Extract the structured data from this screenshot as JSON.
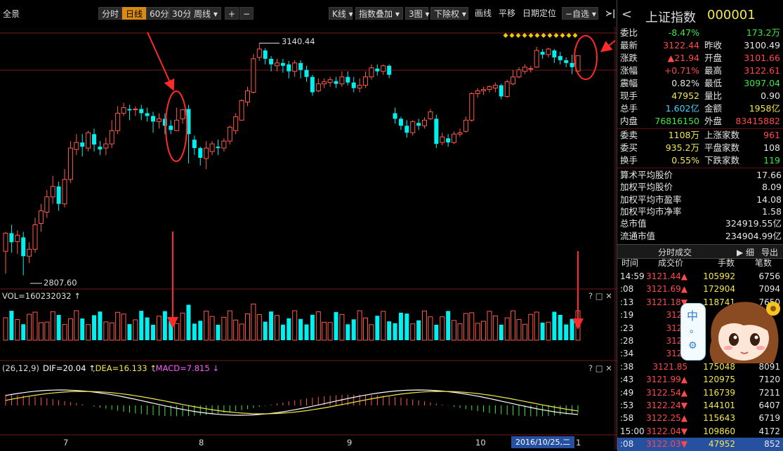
{
  "top": {
    "left_label": "全景",
    "periods": [
      "分时",
      "日线",
      "60分",
      "30分",
      "周线 ▾"
    ],
    "zoom_in": "+",
    "zoom_out": "−",
    "k_type": "K线 ▾",
    "index_overlay": "指数叠加 ▾",
    "charts_count": "3图 ▾",
    "rights": "下除权 ▾",
    "draw": "画线",
    "pan": "平移",
    "date_locate": "日期定位",
    "watchlist": "−自选 ▾",
    "collapse": "≻|"
  },
  "main_chart": {
    "high_label": "3140.44",
    "low_label": "2807.60",
    "candles": [
      [
        2842,
        2868,
        2810,
        2870
      ],
      [
        2868,
        2855,
        2840,
        2880
      ],
      [
        2856,
        2865,
        2838,
        2872
      ],
      [
        2862,
        2835,
        2807.6,
        2870
      ],
      [
        2835,
        2845,
        2825,
        2855
      ],
      [
        2845,
        2880,
        2840,
        2890
      ],
      [
        2882,
        2900,
        2870,
        2910
      ],
      [
        2898,
        2920,
        2890,
        2930
      ],
      [
        2920,
        2935,
        2910,
        2950
      ],
      [
        2935,
        2910,
        2900,
        2942
      ],
      [
        2910,
        2945,
        2905,
        2960
      ],
      [
        2945,
        2990,
        2940,
        3000
      ],
      [
        2988,
        2998,
        2980,
        3010
      ],
      [
        2998,
        2992,
        2978,
        3010
      ],
      [
        2990,
        3012,
        2985,
        3015
      ],
      [
        3010,
        2995,
        2985,
        3018
      ],
      [
        2992,
        2988,
        2980,
        3000
      ],
      [
        2990,
        2996,
        2980,
        3005
      ],
      [
        2996,
        3015,
        2990,
        3030
      ],
      [
        3015,
        3040,
        3010,
        3050
      ],
      [
        3040,
        3048,
        3036,
        3055
      ],
      [
        3046,
        3044,
        3030,
        3052
      ],
      [
        3045,
        3046,
        3036,
        3050
      ],
      [
        3046,
        3040,
        3030,
        3052
      ],
      [
        3040,
        3036,
        3028,
        3048
      ],
      [
        3036,
        3028,
        3012,
        3042
      ],
      [
        3028,
        3032,
        3018,
        3040
      ],
      [
        3032,
        3022,
        3010,
        3040
      ],
      [
        3022,
        3016,
        3010,
        3030
      ],
      [
        3015,
        3030,
        3014,
        3048
      ],
      [
        3032,
        3045,
        3025,
        3046
      ],
      [
        3046,
        3010,
        2968,
        3052
      ],
      [
        3002,
        2990,
        2980,
        3008
      ],
      [
        2990,
        2976,
        2965,
        2992
      ],
      [
        2975,
        2990,
        2960,
        3000
      ],
      [
        2985,
        2996,
        2980,
        3000
      ],
      [
        2992,
        2990,
        2980,
        3002
      ],
      [
        2990,
        3000,
        2985,
        3004
      ],
      [
        3000,
        3020,
        2995,
        3022
      ],
      [
        3015,
        3035,
        3010,
        3040
      ],
      [
        3030,
        3058,
        3030,
        3060
      ],
      [
        3056,
        3072,
        3050,
        3078
      ],
      [
        3070,
        3118,
        3068,
        3125
      ],
      [
        3120,
        3132,
        3115,
        3140.44
      ],
      [
        3130,
        3118,
        3110,
        3133
      ],
      [
        3118,
        3110,
        3100,
        3122
      ],
      [
        3108,
        3112,
        3100,
        3118
      ],
      [
        3112,
        3108,
        3098,
        3118
      ],
      [
        3110,
        3100,
        3090,
        3115
      ],
      [
        3100,
        3112,
        3092,
        3116
      ],
      [
        3112,
        3102,
        3090,
        3116
      ],
      [
        3102,
        3092,
        3085,
        3108
      ],
      [
        3092,
        3070,
        3065,
        3095
      ],
      [
        3072,
        3082,
        3070,
        3090
      ],
      [
        3082,
        3085,
        3076,
        3090
      ],
      [
        3084,
        3088,
        3078,
        3092
      ],
      [
        3086,
        3082,
        3076,
        3092
      ],
      [
        3082,
        3092,
        3078,
        3100
      ],
      [
        3092,
        3084,
        3080,
        3100
      ],
      [
        3084,
        3076,
        3070,
        3092
      ],
      [
        3076,
        3080,
        3070,
        3090
      ],
      [
        3080,
        3092,
        3076,
        3100
      ],
      [
        3092,
        3105,
        3088,
        3110
      ],
      [
        3104,
        3100,
        3094,
        3110
      ],
      [
        3100,
        3108,
        3095,
        3110
      ],
      [
        3108,
        3095,
        3090,
        3110
      ],
      [
        3040,
        3032,
        3025,
        3048
      ],
      [
        3032,
        3022,
        3016,
        3035
      ],
      [
        3022,
        3012,
        3005,
        3030
      ],
      [
        3012,
        3028,
        3008,
        3030
      ],
      [
        3026,
        3022,
        3016,
        3032
      ],
      [
        3022,
        3030,
        3018,
        3034
      ],
      [
        3032,
        3042,
        3030,
        3046
      ],
      [
        3032,
        2996,
        2990,
        3038
      ],
      [
        2998,
        3006,
        2994,
        3012
      ],
      [
        3004,
        2998,
        2992,
        3010
      ],
      [
        2998,
        3010,
        2996,
        3014
      ],
      [
        3010,
        3012,
        3006,
        3018
      ],
      [
        3014,
        3030,
        3012,
        3035
      ],
      [
        3030,
        3068,
        3028,
        3070
      ],
      [
        3068,
        3072,
        3062,
        3076
      ],
      [
        3072,
        3074,
        3066,
        3078
      ],
      [
        3074,
        3078,
        3070,
        3080
      ],
      [
        3076,
        3080,
        3070,
        3084
      ],
      [
        3080,
        3064,
        3060,
        3082
      ],
      [
        3064,
        3085,
        3062,
        3088
      ],
      [
        3082,
        3092,
        3080,
        3102
      ],
      [
        3092,
        3102,
        3090,
        3106
      ],
      [
        3100,
        3106,
        3096,
        3110
      ],
      [
        3104,
        3104,
        3098,
        3108
      ],
      [
        3106,
        3130,
        3105,
        3135
      ],
      [
        3128,
        3124,
        3118,
        3132
      ],
      [
        3124,
        3132,
        3120,
        3134
      ],
      [
        3130,
        3120,
        3112,
        3132
      ],
      [
        3122,
        3116,
        3110,
        3128
      ],
      [
        3116,
        3112,
        3106,
        3120
      ],
      [
        3112,
        3106,
        3096,
        3124
      ],
      [
        3100.49,
        3122.44,
        3097.04,
        3122.61
      ]
    ]
  },
  "vol_panel": {
    "label": "VOL=160232032 ↑"
  },
  "macd_panel": {
    "params": "(26,12,9)",
    "dif": "DIF=20.04 ↑",
    "dea": ",DEA=16.133 ↑",
    "macd": ",MACD=7.815 ↓"
  },
  "date_axis": {
    "labels": [
      "7",
      "8",
      "9",
      "10"
    ],
    "current_date": "2016/10/25,二",
    "last": "1"
  },
  "quote": {
    "back": "<",
    "name": "上证指数",
    "code": "000001",
    "rows": [
      {
        "l1": "委比",
        "v1": "-8.47%",
        "c1": "green",
        "l2": "",
        "v2": "173.2万",
        "c2": "green"
      },
      {
        "l1": "最新",
        "v1": "3122.44",
        "c1": "red",
        "l2": "昨收",
        "v2": "3100.49",
        "c2": "white"
      },
      {
        "l1": "涨跌",
        "v1": "▲21.94",
        "c1": "red",
        "l2": "开盘",
        "v2": "3101.66",
        "c2": "red"
      },
      {
        "l1": "涨幅",
        "v1": "+0.71%",
        "c1": "red",
        "l2": "最高",
        "v2": "3122.61",
        "c2": "red"
      },
      {
        "l1": "震幅",
        "v1": "0.82%",
        "c1": "white",
        "l2": "最低",
        "v2": "3097.04",
        "c2": "green"
      },
      {
        "l1": "现手",
        "v1": "47952",
        "c1": "yellow",
        "l2": "量比",
        "v2": "0.90",
        "c2": "white"
      },
      {
        "l1": "总手",
        "v1": "1.602亿",
        "c1": "cyan",
        "l2": "金额",
        "v2": "1958亿",
        "c2": "yellow"
      },
      {
        "l1": "内盘",
        "v1": "76816150",
        "c1": "green",
        "l2": "外盘",
        "v2": "83415882",
        "c2": "red"
      }
    ],
    "rows2": [
      {
        "l1": "委卖",
        "v1": "1108万",
        "c1": "yellow",
        "l2": "上涨家数",
        "v2": "961",
        "c2": "red"
      },
      {
        "l1": "委买",
        "v1": "935.2万",
        "c1": "yellow",
        "l2": "平盘家数",
        "v2": "108",
        "c2": "white"
      },
      {
        "l1": "换手",
        "v1": "0.55%",
        "c1": "yellow",
        "l2": "下跌家数",
        "v2": "119",
        "c2": "green"
      }
    ],
    "stats": [
      {
        "label": "算术平均股价",
        "value": "17.66"
      },
      {
        "label": "加权平均股价",
        "value": "8.09"
      },
      {
        "label": "加权平均市盈率",
        "value": "14.08"
      },
      {
        "label": "加权平均市净率",
        "value": "1.58"
      },
      {
        "label": "总市值",
        "value": "324919.55亿"
      },
      {
        "label": "流通市值",
        "value": "234904.99亿"
      }
    ]
  },
  "trades": {
    "tab": "分时成交",
    "tab2": "▶ 细",
    "export": "导出",
    "headers": [
      "时间",
      "成交价",
      "手数",
      "笔数"
    ],
    "rows": [
      {
        "t": "14:59",
        "p": "3121.44▲",
        "pc": "red",
        "v": "105992",
        "vc": "yellow",
        "n": "6756"
      },
      {
        "t": ":08",
        "p": "3121.69▲",
        "pc": "red",
        "v": "172904",
        "vc": "yellow",
        "n": "7094"
      },
      {
        "t": ":13",
        "p": "3121.18▼",
        "pc": "red",
        "v": "118741",
        "vc": "yellow",
        "n": "7650"
      },
      {
        "t": ":19",
        "p": "3121",
        "pc": "red",
        "v": "",
        "vc": "yellow",
        "n": ""
      },
      {
        "t": ":23",
        "p": "3121",
        "pc": "red",
        "v": "",
        "vc": "yellow",
        "n": ""
      },
      {
        "t": ":28",
        "p": "3120",
        "pc": "red",
        "v": "",
        "vc": "yellow",
        "n": ""
      },
      {
        "t": ":34",
        "p": "3121",
        "pc": "red",
        "v": "",
        "vc": "yellow",
        "n": ""
      },
      {
        "t": ":38",
        "p": "3121.85",
        "pc": "red",
        "v": "175048",
        "vc": "yellow",
        "n": "8091"
      },
      {
        "t": ":43",
        "p": "3121.99▲",
        "pc": "red",
        "v": "120975",
        "vc": "yellow",
        "n": "7120"
      },
      {
        "t": ":49",
        "p": "3122.54▲",
        "pc": "red",
        "v": "116739",
        "vc": "yellow",
        "n": "7211"
      },
      {
        "t": ":53",
        "p": "3122.24▼",
        "pc": "red",
        "v": "144101",
        "vc": "yellow",
        "n": "6407"
      },
      {
        "t": ":58",
        "p": "3122.25▲",
        "pc": "red",
        "v": "115643",
        "vc": "yellow",
        "n": "6719"
      },
      {
        "t": "15:00",
        "p": "3122.04▼",
        "pc": "red",
        "v": "109860",
        "vc": "yellow",
        "n": "4172"
      },
      {
        "t": ":08",
        "p": "3122.03▼",
        "pc": "red",
        "v": "47952",
        "vc": "yellow",
        "n": "852"
      }
    ]
  },
  "mascot": {
    "text": "中",
    "dot": "。",
    "gear": "⚙"
  }
}
